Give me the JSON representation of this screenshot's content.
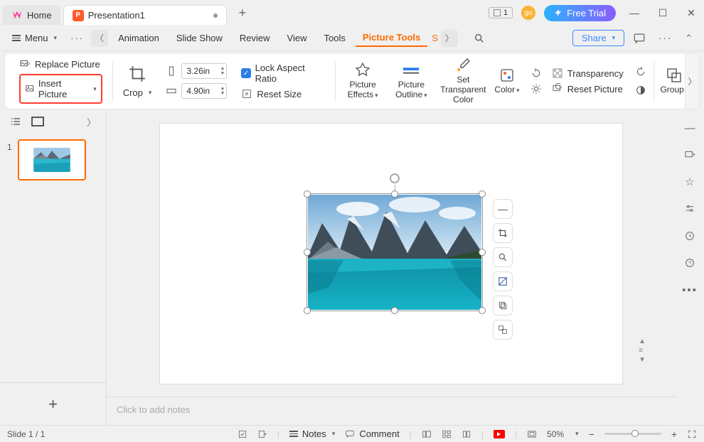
{
  "titlebar": {
    "home_label": "Home",
    "doc_label": "Presentation1",
    "counter": "1",
    "free_trial": "Free Trial"
  },
  "menubar": {
    "menu": "Menu",
    "tabs": [
      "Animation",
      "Slide Show",
      "Review",
      "View",
      "Tools"
    ],
    "active_tab": "Picture Tools",
    "overflow_initial": "S",
    "share": "Share"
  },
  "ribbon": {
    "replace_picture": "Replace Picture",
    "insert_picture": "Insert Picture",
    "crop": "Crop",
    "width": "3.26in",
    "height": "4.90in",
    "lock_aspect": "Lock Aspect Ratio",
    "reset_size": "Reset Size",
    "picture_effects": "Picture Effects",
    "picture_outline": "Picture Outline",
    "set_transparent": "Set Transparent Color",
    "color": "Color",
    "transparency": "Transparency",
    "reset_picture": "Reset Picture",
    "group": "Group"
  },
  "thumbs": {
    "items": [
      {
        "num": "1"
      }
    ]
  },
  "notes_placeholder": "Click to add notes",
  "statusbar": {
    "slide_pos": "Slide 1 / 1",
    "notes": "Notes",
    "comment": "Comment",
    "zoom": "50%"
  }
}
